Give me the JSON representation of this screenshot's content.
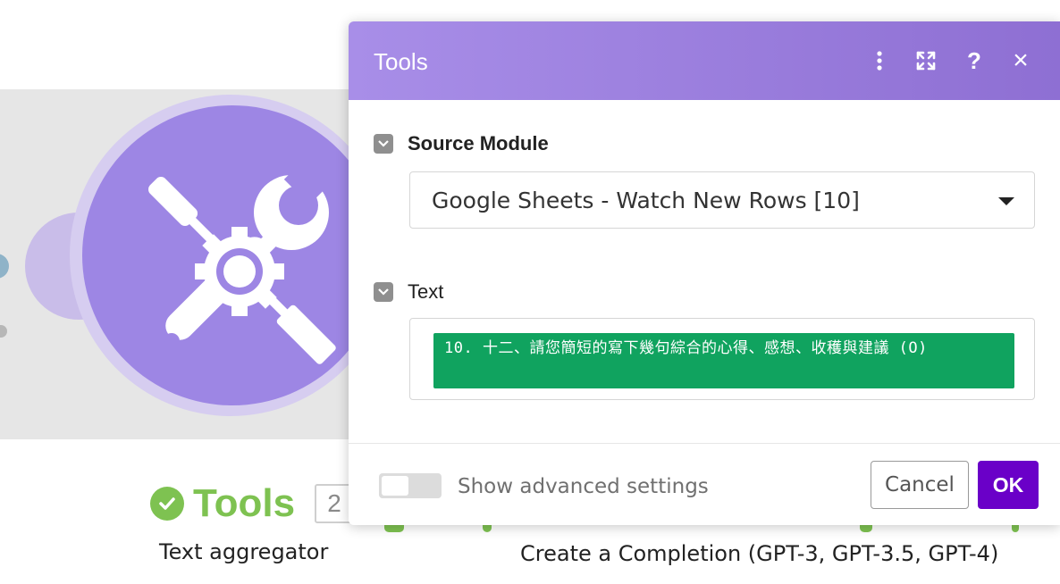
{
  "canvas": {
    "module1": {
      "name": "Tools",
      "badge": "2",
      "subtitle": "Text aggregator"
    },
    "module2": {
      "subtitle": "Create a Completion (GPT-3, GPT-3.5, GPT-4)"
    },
    "colors": {
      "module": "#9d86e4",
      "success": "#7ec251"
    }
  },
  "dialog": {
    "title": "Tools",
    "header_icons": [
      "more-vertical-icon",
      "expand-icon",
      "help-icon",
      "close-icon"
    ],
    "help_glyph": "?",
    "close_glyph": "×",
    "source_module": {
      "label": "Source Module",
      "selected": "Google Sheets - Watch New Rows [10]"
    },
    "text_field": {
      "label": "Text",
      "pill": "10. 十二、請您簡短的寫下幾句綜合的心得、感想、收穫與建議 (O)"
    },
    "advanced_toggle": {
      "label": "Show advanced settings",
      "on": false
    },
    "cancel_label": "Cancel",
    "ok_label": "OK",
    "colors": {
      "header_start": "#a88ee8",
      "header_end": "#8e6fd3",
      "ok": "#6a00c8",
      "pill": "#10a35f"
    }
  }
}
